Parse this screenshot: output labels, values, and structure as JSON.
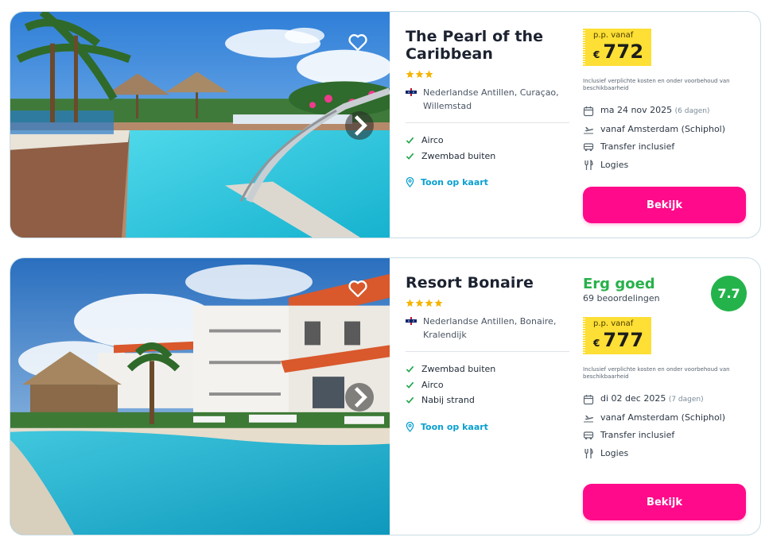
{
  "hotels": [
    {
      "name": "The Pearl of the Caribbean",
      "stars": 3,
      "location": "Nederlandse Antillen, Curaçao, Willemstad",
      "features": [
        "Airco",
        "Zwembad buiten"
      ],
      "map_link": "Toon op kaart",
      "price_label": "p.p. vanaf",
      "currency": "€",
      "price": "772",
      "disclaimer": "Inclusief verplichte kosten en onder voorbehoud van beschikbaarheid",
      "date": "ma 24 nov 2025",
      "duration": "(6 dagen)",
      "departure": "vanaf Amsterdam (Schiphol)",
      "transfer": "Transfer inclusief",
      "board": "Logies",
      "cta": "Bekijk"
    },
    {
      "name": "Resort Bonaire",
      "stars": 4,
      "rating_label": "Erg goed",
      "rating_count": "69 beoordelingen",
      "score": "7.7",
      "location": "Nederlandse Antillen, Bonaire, Kralendijk",
      "features": [
        "Zwembad buiten",
        "Airco",
        "Nabij strand"
      ],
      "map_link": "Toon op kaart",
      "price_label": "p.p. vanaf",
      "currency": "€",
      "price": "777",
      "disclaimer": "Inclusief verplichte kosten en onder voorbehoud van beschikbaarheid",
      "date": "di 02 dec 2025",
      "duration": "(7 dagen)",
      "departure": "vanaf Amsterdam (Schiphol)",
      "transfer": "Transfer inclusief",
      "board": "Logies",
      "cta": "Bekijk"
    }
  ],
  "icons": {
    "favorite": "heart-icon",
    "next": "chevron-right-icon",
    "star": "star-icon",
    "check": "check-icon",
    "map": "map-pin-icon",
    "calendar": "calendar-icon",
    "flight": "plane-icon",
    "transfer": "bus-icon",
    "board": "fork-knife-icon"
  },
  "colors": {
    "cta": "#ff0a8a",
    "price_bg": "#fddf35",
    "rating": "#24b34b",
    "link": "#0aa0d0",
    "check": "#1fa64a",
    "star": "#f4b400"
  }
}
